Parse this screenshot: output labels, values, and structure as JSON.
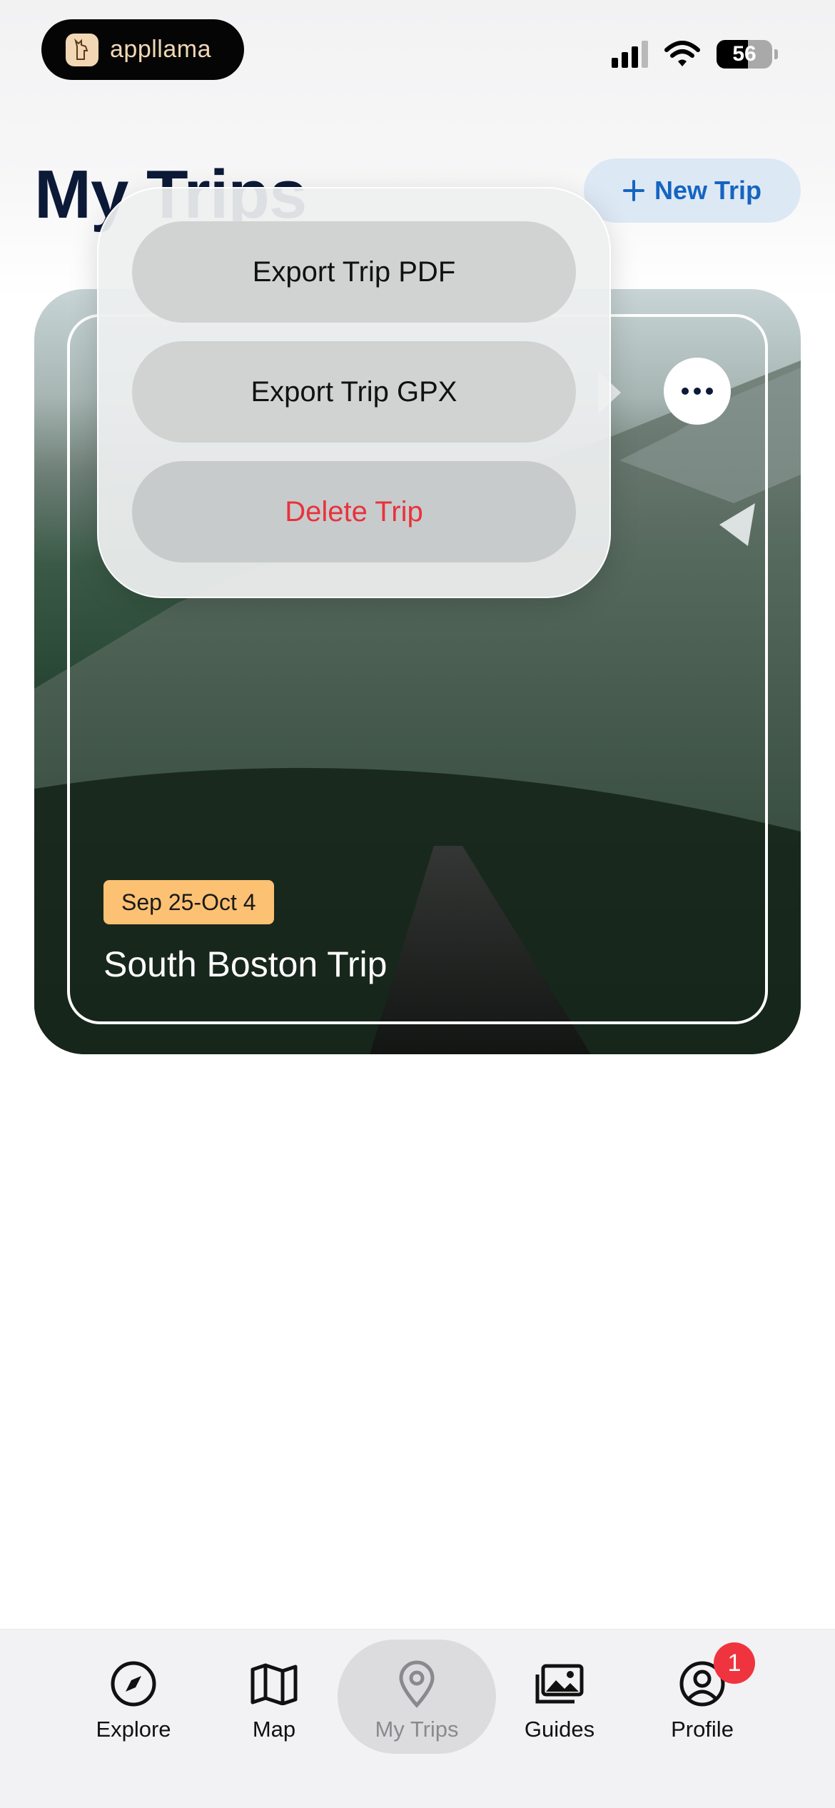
{
  "status_bar": {
    "brand": "appllama",
    "battery": "56",
    "battery_level": 0.56
  },
  "header": {
    "title": "My Trips",
    "new_trip_label": "New Trip"
  },
  "trip_card": {
    "date_range": "Sep 25-Oct 4",
    "name": "South Boston Trip"
  },
  "menu": {
    "items": [
      {
        "label": "Export Trip PDF"
      },
      {
        "label": "Export Trip GPX"
      },
      {
        "label": "Delete Trip"
      }
    ]
  },
  "tabs": [
    {
      "label": "Explore",
      "icon": "compass-icon"
    },
    {
      "label": "Map",
      "icon": "map-icon"
    },
    {
      "label": "My Trips",
      "icon": "location-pin-icon",
      "active": true
    },
    {
      "label": "Guides",
      "icon": "photos-icon"
    },
    {
      "label": "Profile",
      "icon": "profile-icon",
      "badge": "1"
    }
  ],
  "colors": {
    "accent": "#1565c0",
    "danger": "#e8323d",
    "badge": "#fcc173",
    "title": "#0c1a38"
  }
}
